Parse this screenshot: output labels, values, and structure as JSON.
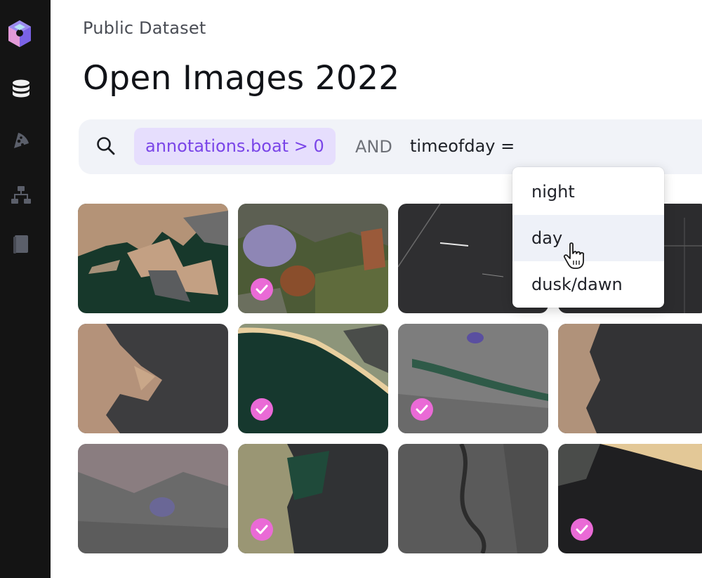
{
  "header": {
    "subtitle": "Public Dataset",
    "title": "Open Images 2022"
  },
  "sidebar": {
    "logo": "hex-cube-logo",
    "items": [
      {
        "icon": "database-icon"
      },
      {
        "icon": "pizza-slice-icon"
      },
      {
        "icon": "network-icon"
      },
      {
        "icon": "book-icon"
      }
    ]
  },
  "search": {
    "icon": "search-icon",
    "chip": "annotations.boat > 0",
    "operator": "AND",
    "query": "timeofday ="
  },
  "dropdown": {
    "options": [
      "night",
      "day",
      "dusk/dawn"
    ],
    "hovered": "day"
  },
  "grid": {
    "tiles": [
      {
        "scene": "harbor-green",
        "selected": false
      },
      {
        "scene": "forest-mountain",
        "selected": true
      },
      {
        "scene": "dark-sea-lines",
        "selected": false
      },
      {
        "scene": "dark-sea-grid",
        "selected": false
      },
      {
        "scene": "coast-sand-dark",
        "selected": false
      },
      {
        "scene": "bay-beach-green",
        "selected": true
      },
      {
        "scene": "city-river-gray",
        "selected": true
      },
      {
        "scene": "coast-dark-sea",
        "selected": false
      },
      {
        "scene": "city-hills-gray",
        "selected": false
      },
      {
        "scene": "coast-green-dark",
        "selected": true
      },
      {
        "scene": "city-river-dark",
        "selected": false
      },
      {
        "scene": "beach-dark-sea",
        "selected": true
      }
    ]
  },
  "colors": {
    "sidebar": "#141414",
    "accent_purple": "#7a45e8",
    "chip_bg": "#e6defd",
    "check_pink": "#ea6ad6",
    "search_bg": "#f1f3f8"
  }
}
